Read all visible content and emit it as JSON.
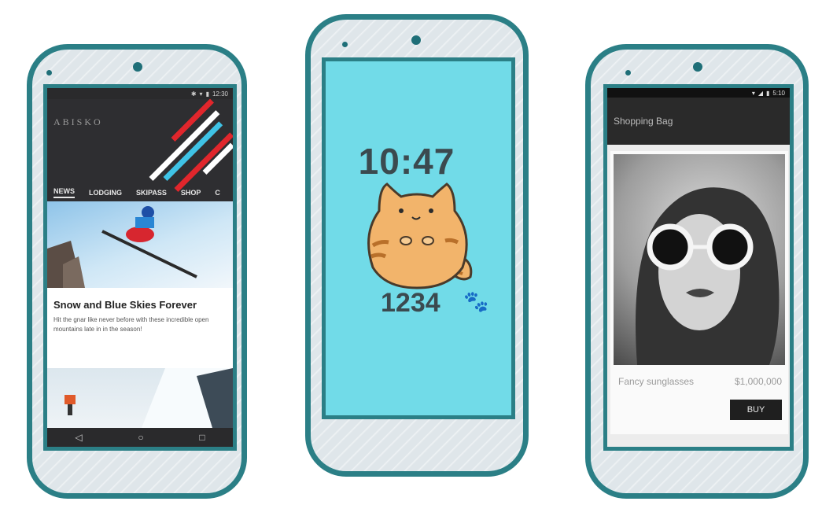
{
  "phone_left": {
    "status_time": "12:30",
    "logo": "ABISKO",
    "tabs": [
      "NEWS",
      "LODGING",
      "SKIPASS",
      "SHOP",
      "C"
    ],
    "article_title": "Snow and Blue Skies Forever",
    "article_body": "Hit the gnar like never before with these incredible open mountains late in in the season!",
    "nav_back": "◁",
    "nav_home": "○",
    "nav_recent": "□"
  },
  "phone_center": {
    "time": "10:47",
    "steps": "1234"
  },
  "phone_right": {
    "status_time": "5:10",
    "app_title": "Shopping Bag",
    "product_name": "Fancy sunglasses",
    "product_price": "$1,000,000",
    "buy_label": "BUY"
  },
  "colors": {
    "outline": "#2b7f86",
    "watch_bg": "#71dbe8",
    "stripe_red": "#e1262c",
    "stripe_blue": "#3fc3e6",
    "stripe_white": "#ffffff"
  },
  "icons": [
    "wifi-icon",
    "signal-icon",
    "battery-icon",
    "bluetooth-icon",
    "paw-icon"
  ]
}
